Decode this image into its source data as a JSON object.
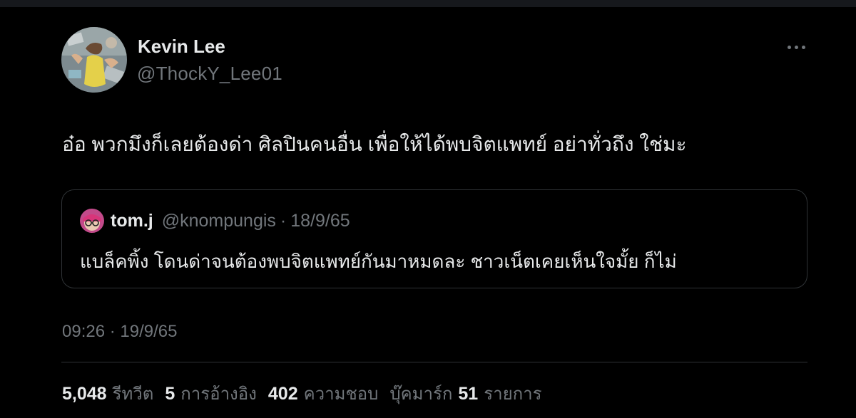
{
  "tweet": {
    "author": {
      "display_name": "Kevin Lee",
      "handle": "@ThockY_Lee01"
    },
    "more_icon": "more-horizontal-icon",
    "text": "อ๋อ พวกมึงก็เลยต้องด่า ศิลปินคนอื่น เพื่อให้ได้พบจิตแพทย์ อย่าทั่วถึง ใช่มะ",
    "quote": {
      "display_name": "tom.j",
      "handle": "@knompungis",
      "separator": "·",
      "date": "18/9/65",
      "text": "แบล็คพิ้ง โดนด่าจนต้องพบจิตแพทย์กันมาหมดละ ชาวเน็ตเคยเห็นใจมั้ย ก็ไม่"
    },
    "timestamp": {
      "time": "09:26",
      "separator": "·",
      "date": "19/9/65"
    },
    "stats": [
      {
        "count": "5,048",
        "label": "รีทวีต"
      },
      {
        "count": "5",
        "label": "การอ้างอิง"
      },
      {
        "count": "402",
        "label": "ความชอบ"
      },
      {
        "prefix": "บุ๊คมาร์ก",
        "count": "51",
        "label": "รายการ"
      }
    ]
  },
  "colors": {
    "background": "#000000",
    "primary_text": "#e7e9ea",
    "secondary_text": "#71767b",
    "border": "#2f3336"
  }
}
